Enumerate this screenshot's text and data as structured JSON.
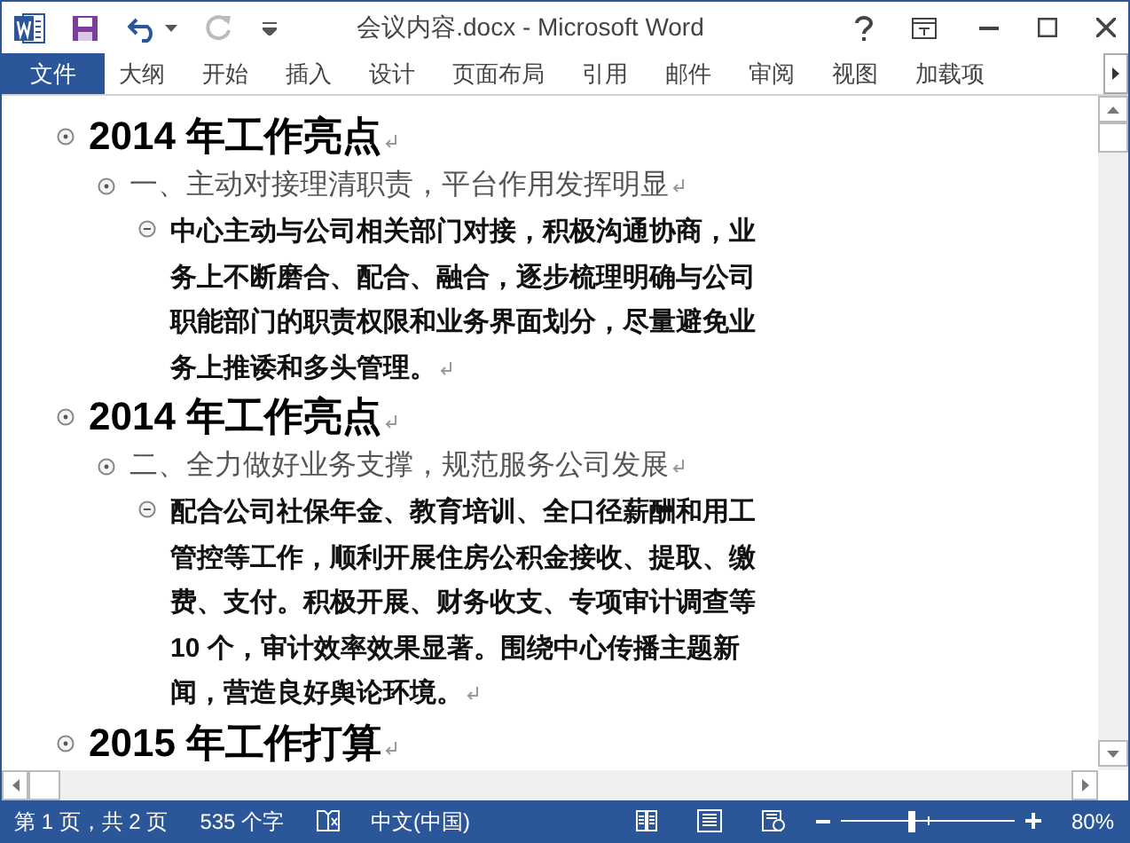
{
  "window": {
    "title": "会议内容.docx - Microsoft Word",
    "redo_disabled": true
  },
  "ribbon_tabs": [
    {
      "label": "文件",
      "kind": "file"
    },
    {
      "label": "大纲",
      "kind": "tab"
    },
    {
      "label": "开始",
      "kind": "tab"
    },
    {
      "label": "插入",
      "kind": "tab"
    },
    {
      "label": "设计",
      "kind": "tab"
    },
    {
      "label": "页面布局",
      "kind": "tab"
    },
    {
      "label": "引用",
      "kind": "tab"
    },
    {
      "label": "邮件",
      "kind": "tab"
    },
    {
      "label": "审阅",
      "kind": "tab"
    },
    {
      "label": "视图",
      "kind": "tab"
    },
    {
      "label": "加载项",
      "kind": "tab"
    }
  ],
  "outline": [
    {
      "text": "2014 年工作亮点",
      "kind": "level1",
      "children": [
        {
          "text": "一、主动对接理清职责，平台作用发挥明显",
          "kind": "level2",
          "children": [
            {
              "text": "中心主动与公司相关部门对接，积极沟通协商，业务上不断磨合、配合、融合，逐步梳理明确与公司职能部门的职责权限和业务界面划分，尽量避免业务上推诿和多头管理。",
              "kind": "body"
            }
          ]
        }
      ]
    },
    {
      "text": "2014 年工作亮点",
      "kind": "level1",
      "children": [
        {
          "text": "二、全力做好业务支撑，规范服务公司发展",
          "kind": "level2",
          "children": [
            {
              "text": "配合公司社保年金、教育培训、全口径薪酬和用工管控等工作，顺利开展住房公积金接收、提取、缴费、支付。积极开展、财务收支、专项审计调查等 10 个，审计效率效果显著。围绕中心传播主题新闻，营造良好舆论环境。",
              "kind": "body"
            }
          ]
        }
      ]
    },
    {
      "text": "2015 年工作打算",
      "kind": "level1"
    }
  ],
  "status_bar": {
    "page": "第 1 页，共 2 页",
    "words": "535 个字",
    "language": "中文(中国)",
    "zoom": {
      "level": 0.4,
      "reading": "80%"
    }
  }
}
